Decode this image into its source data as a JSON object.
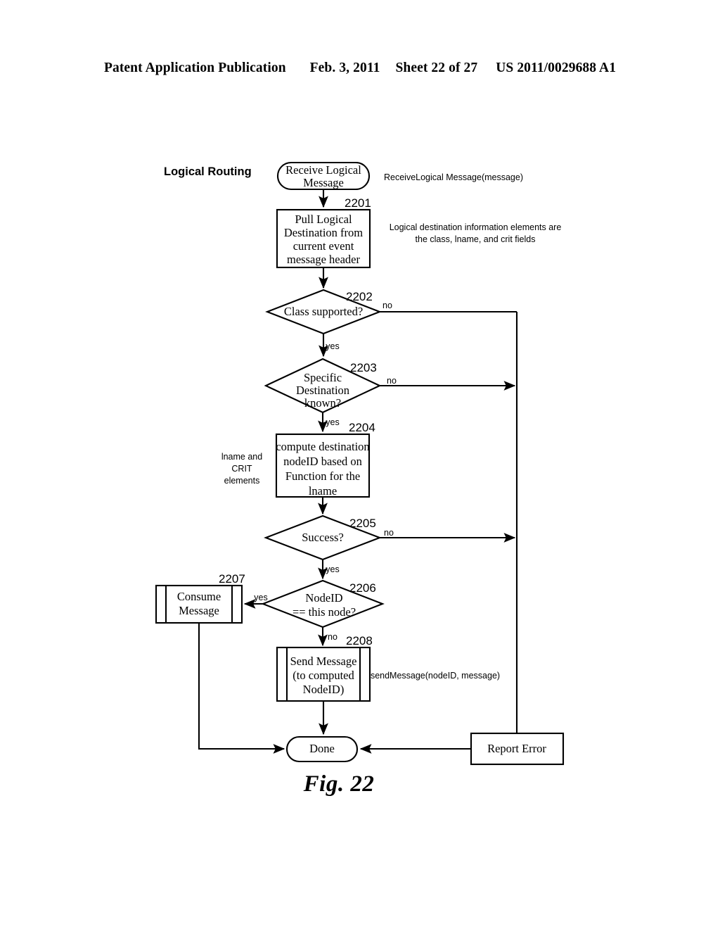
{
  "header": {
    "publication": "Patent Application Publication",
    "date": "Feb. 3, 2011",
    "sheet": "Sheet 22 of 27",
    "patent_number": "US 2011/0029688 A1"
  },
  "figure": {
    "caption": "Fig. 22",
    "diagram_title": "Logical Routing"
  },
  "nodes": {
    "start": {
      "ref": "",
      "lines": [
        "Receive Logical",
        "Message"
      ],
      "shape": "terminal"
    },
    "n2201": {
      "ref": "2201",
      "lines": [
        "Pull Logical",
        "Destination from",
        "current event",
        "message header"
      ],
      "shape": "process"
    },
    "n2202": {
      "ref": "2202",
      "lines": [
        "Class supported?"
      ],
      "shape": "decision"
    },
    "n2203": {
      "ref": "2203",
      "lines": [
        "Specific",
        "Destination",
        "known?"
      ],
      "shape": "decision"
    },
    "n2204": {
      "ref": "2204",
      "lines": [
        "compute destination",
        "nodeID based on",
        "Function for the",
        "lname"
      ],
      "shape": "process"
    },
    "n2205": {
      "ref": "2205",
      "lines": [
        "Success?"
      ],
      "shape": "decision"
    },
    "n2206": {
      "ref": "2206",
      "lines": [
        "NodeID",
        "== this node?"
      ],
      "shape": "decision"
    },
    "n2207": {
      "ref": "2207",
      "lines": [
        "Consume",
        "Message"
      ],
      "shape": "predefined-process"
    },
    "n2208": {
      "ref": "2208",
      "lines": [
        "Send Message",
        "(to computed",
        "NodeID)"
      ],
      "shape": "predefined-process"
    },
    "report_error": {
      "ref": "",
      "lines": [
        "Report Error"
      ],
      "shape": "process"
    },
    "done": {
      "ref": "",
      "lines": [
        "Done"
      ],
      "shape": "terminal"
    }
  },
  "edge_labels": {
    "e2202_no": "no",
    "e2202_yes": "yes",
    "e2203_no": "no",
    "e2203_yes": "yes",
    "e2205_no": "no",
    "e2205_yes": "yes",
    "e2206_yes": "yes",
    "e2206_no": "no"
  },
  "annotations": {
    "receive_call": "ReceiveLogical Message(message)",
    "logical_dest_1": "Logical destination information elements are",
    "logical_dest_2": "the class, lname, and crit fields",
    "lname_crit_1": "lname and",
    "lname_crit_2": "CRIT",
    "lname_crit_3": "elements",
    "send_call": "sendMessage(nodeID, message)"
  },
  "colors": {
    "ink": "#000000",
    "paper": "#ffffff"
  }
}
